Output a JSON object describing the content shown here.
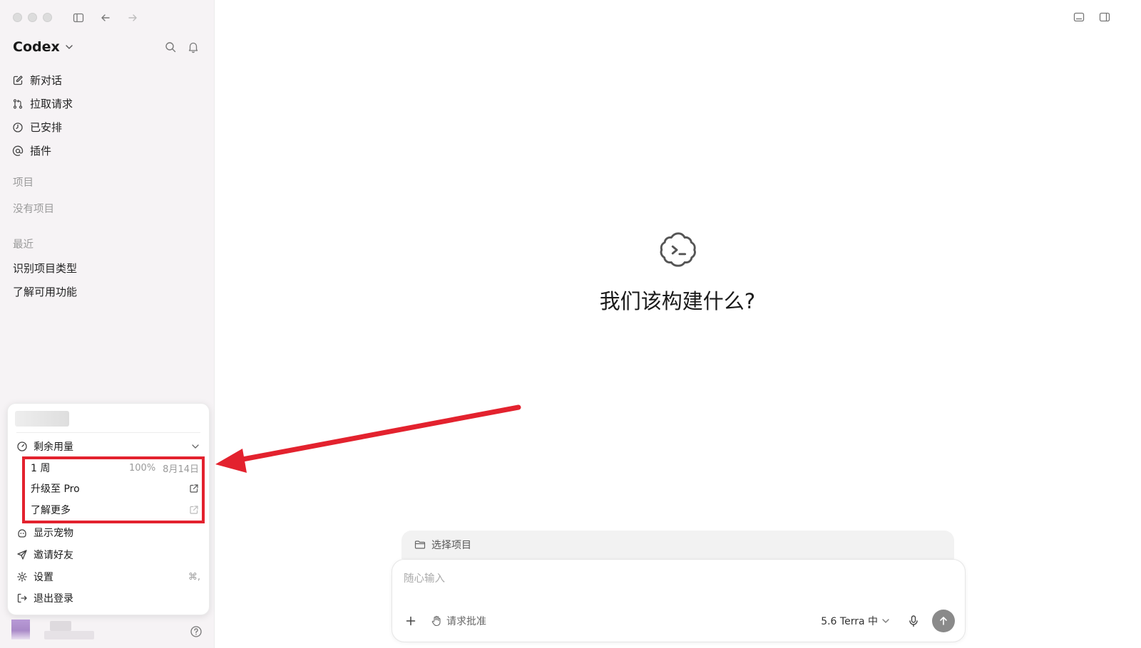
{
  "sidebar": {
    "brand": "Codex",
    "nav": [
      {
        "label": "新对话",
        "icon": "compose-icon"
      },
      {
        "label": "拉取请求",
        "icon": "pull-request-icon"
      },
      {
        "label": "已安排",
        "icon": "clock-icon"
      },
      {
        "label": "插件",
        "icon": "at-icon"
      }
    ],
    "projects_label": "项目",
    "no_projects": "没有项目",
    "recent_label": "最近",
    "recent": [
      "识别项目类型",
      "了解可用功能"
    ]
  },
  "popup": {
    "usage_label": "剩余用量",
    "week_label": "1 周",
    "week_percent": "100%",
    "week_date": "8月14日",
    "upgrade_label": "升级至 Pro",
    "learn_more_label": "了解更多",
    "show_pet_label": "显示宠物",
    "invite_label": "邀请好友",
    "settings_label": "设置",
    "settings_shortcut": "⌘,",
    "logout_label": "退出登录"
  },
  "main": {
    "title": "我们该构建什么?",
    "select_project": "选择项目",
    "input_placeholder": "随心输入",
    "approve_label": "请求批准",
    "model_label": "5.6 Terra 中"
  },
  "colors": {
    "annotation_red": "#e3222e",
    "sidebar_bg": "#f6f3f5"
  }
}
